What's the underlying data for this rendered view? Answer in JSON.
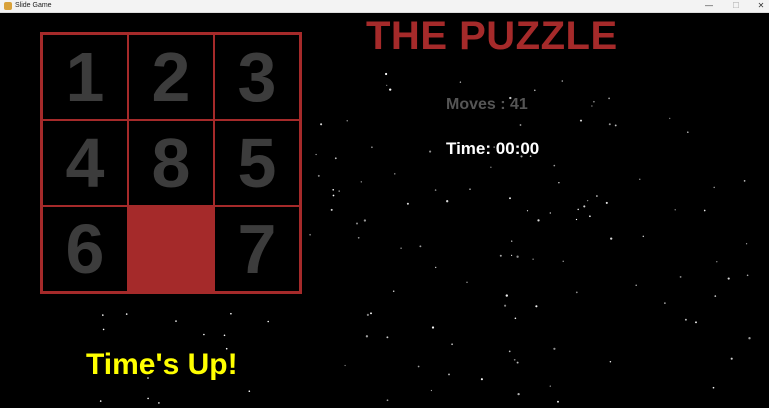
{
  "window": {
    "title": "Slide Game",
    "minimize": "—",
    "maximize": "☐",
    "close": "✕"
  },
  "game": {
    "title": "THE PUZZLE",
    "moves_label": "Moves :",
    "moves_value": "41",
    "time_label": "Time:",
    "time_value": "00:00",
    "message": "Time's Up!"
  },
  "board": {
    "tiles": [
      "1",
      "2",
      "3",
      "4",
      "8",
      "5",
      "6",
      "",
      "7"
    ]
  },
  "colors": {
    "accent": "#a52a2a",
    "tile_text": "#3c3c3c",
    "message": "#ffff00",
    "background": "#000000"
  }
}
